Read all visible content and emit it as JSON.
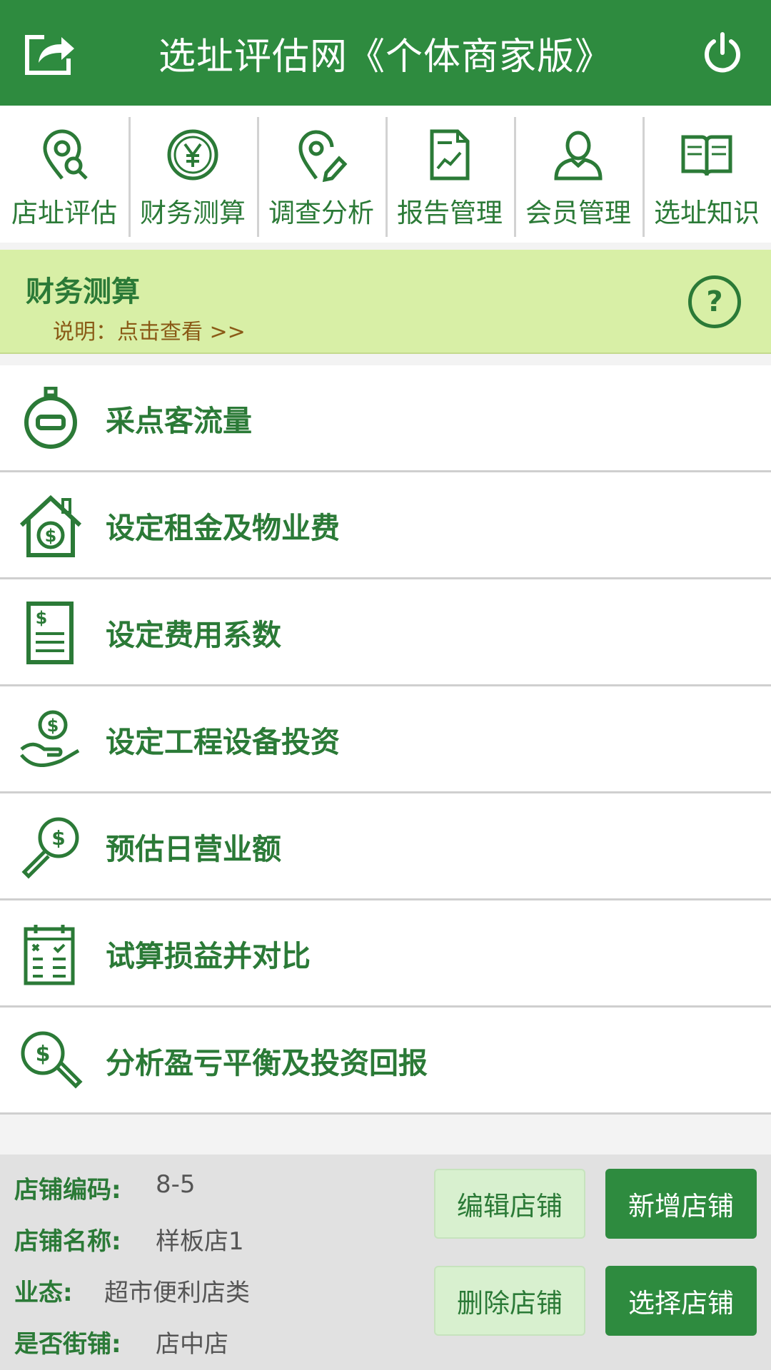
{
  "app": {
    "title": "选址评估网《个体商家版》",
    "accent": "#2e8b3f"
  },
  "nav": [
    {
      "label": "店址评估",
      "icon": "location-search-icon"
    },
    {
      "label": "财务测算",
      "icon": "yen-coin-icon"
    },
    {
      "label": "调查分析",
      "icon": "location-edit-icon"
    },
    {
      "label": "报告管理",
      "icon": "report-chart-icon"
    },
    {
      "label": "会员管理",
      "icon": "user-icon"
    },
    {
      "label": "选址知识",
      "icon": "book-icon"
    }
  ],
  "section": {
    "title": "财务测算",
    "note": "说明：点击查看 >>",
    "help": "?"
  },
  "menu": [
    {
      "label": "采点客流量",
      "icon": "stopwatch-icon"
    },
    {
      "label": "设定租金及物业费",
      "icon": "house-dollar-icon"
    },
    {
      "label": "设定费用系数",
      "icon": "invoice-icon"
    },
    {
      "label": "设定工程设备投资",
      "icon": "hand-coin-icon"
    },
    {
      "label": "预估日营业额",
      "icon": "magnifier-dollar-icon"
    },
    {
      "label": "试算损益并对比",
      "icon": "calendar-calc-icon"
    },
    {
      "label": "分析盈亏平衡及投资回报",
      "icon": "dollar-search-icon"
    }
  ],
  "store": {
    "code_label": "店铺编码:",
    "code": "8-5",
    "name_label": "店铺名称:",
    "name": "样板店1",
    "type_label": "业态:",
    "type": "超市便利店类",
    "street_label": "是否街铺:",
    "street": "店中店"
  },
  "buttons": {
    "edit": "编辑店铺",
    "add": "新增店铺",
    "delete": "删除店铺",
    "select": "选择店铺"
  }
}
